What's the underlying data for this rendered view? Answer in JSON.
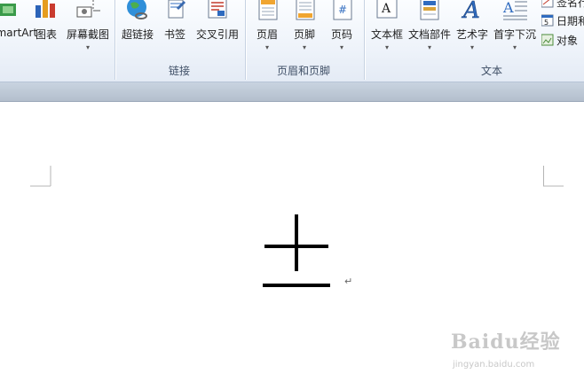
{
  "ribbon": {
    "groups": [
      {
        "label": "链接"
      },
      {
        "label": "页眉和页脚"
      },
      {
        "label": "文本"
      }
    ],
    "buttons": {
      "smartart": "SmartArt",
      "chart": "图表",
      "screenshot": "屏幕截图",
      "hyperlink": "超链接",
      "bookmark": "书签",
      "cross_reference": "交叉引用",
      "header": "页眉",
      "footer": "页脚",
      "page_number": "页码",
      "textbox": "文本框",
      "quick_parts": "文档部件",
      "wordart": "艺术字",
      "drop_cap": "首字下沉"
    },
    "small_items": {
      "signature": "签名行",
      "datetime": "日期和时间",
      "object": "对象"
    },
    "dropdown_glyph": "▾"
  },
  "document": {
    "paragraph_mark": "↵"
  },
  "watermark": {
    "brand": "Baidu经验",
    "url": "jingyan.baidu.com"
  }
}
